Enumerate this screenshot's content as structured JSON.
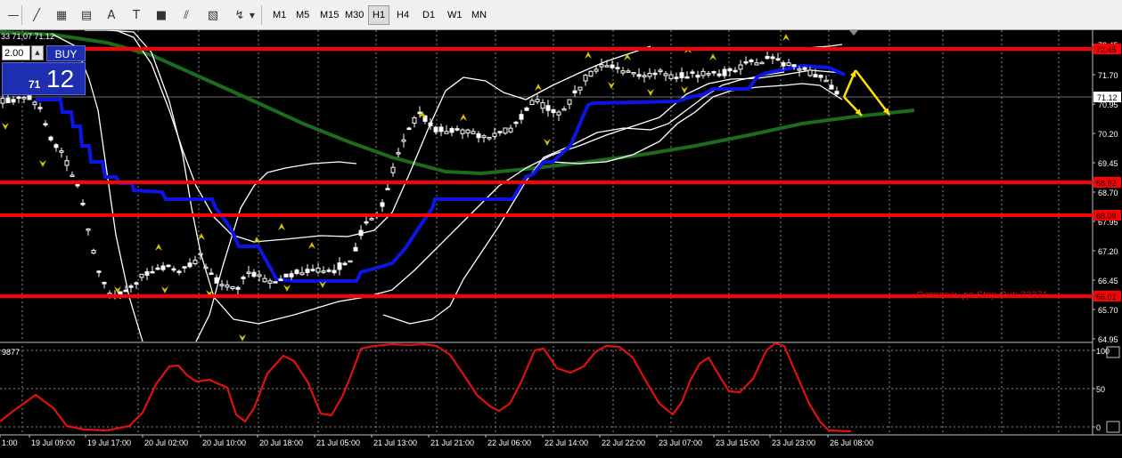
{
  "toolbar": {
    "tools": [
      {
        "icon": "crosshair-line-icon",
        "glyph": "—"
      },
      {
        "icon": "trendline-icon",
        "glyph": "╱"
      },
      {
        "icon": "channel-icon",
        "glyph": "▦"
      },
      {
        "icon": "fibonacci-icon",
        "glyph": "▤"
      },
      {
        "icon": "text-icon",
        "glyph": "A"
      },
      {
        "icon": "text-label-icon",
        "glyph": "T"
      },
      {
        "icon": "rectangle-icon",
        "glyph": "■"
      },
      {
        "icon": "fibo-fan-icon",
        "glyph": "⫽"
      },
      {
        "icon": "gann-icon",
        "glyph": "▧"
      },
      {
        "icon": "arrows-icon",
        "glyph": "↯"
      }
    ],
    "timeframes": [
      "M1",
      "M5",
      "M15",
      "M30",
      "H1",
      "H4",
      "D1",
      "W1",
      "MN"
    ],
    "active_timeframe": "H1"
  },
  "header": {
    "ohlc": "33 71.07 71.12"
  },
  "one_click": {
    "lot": "2.00",
    "buy_label": "BUY",
    "price_small": "71",
    "price_big": "12"
  },
  "price_axis": {
    "ticks": [
      "72.45",
      "71.70",
      "70.95",
      "70.20",
      "69.45",
      "68.70",
      "67.95",
      "67.20",
      "66.45",
      "65.70",
      "64.95"
    ],
    "level_labels": [
      "72.45",
      "68.92",
      "68.09",
      "66.01"
    ],
    "current_price": "71.12"
  },
  "time_axis": {
    "labels": [
      "1:00",
      "19 Jul 09:00",
      "19 Jul 17:00",
      "20 Jul 02:00",
      "20 Jul 10:00",
      "20 Jul 18:00",
      "21 Jul 05:00",
      "21 Jul 13:00",
      "21 Jul 21:00",
      "22 Jul 06:00",
      "22 Jul 14:00",
      "22 Jul 22:00",
      "23 Jul 07:00",
      "23 Jul 15:00",
      "23 Jul 23:00",
      "26 Jul 08:00"
    ]
  },
  "stop_out_text": "Осталось до Stop Out: 33371",
  "oscillator": {
    "label": "9877",
    "ticks": [
      "100",
      "50",
      "0"
    ]
  },
  "colors": {
    "bg": "#000000",
    "level": "#ff0000",
    "ma": "#1d6b1d",
    "channel": "#0b16e6",
    "bands": "#ffffff",
    "arrows": "#ffe100",
    "oscillator": "#e01010"
  }
}
